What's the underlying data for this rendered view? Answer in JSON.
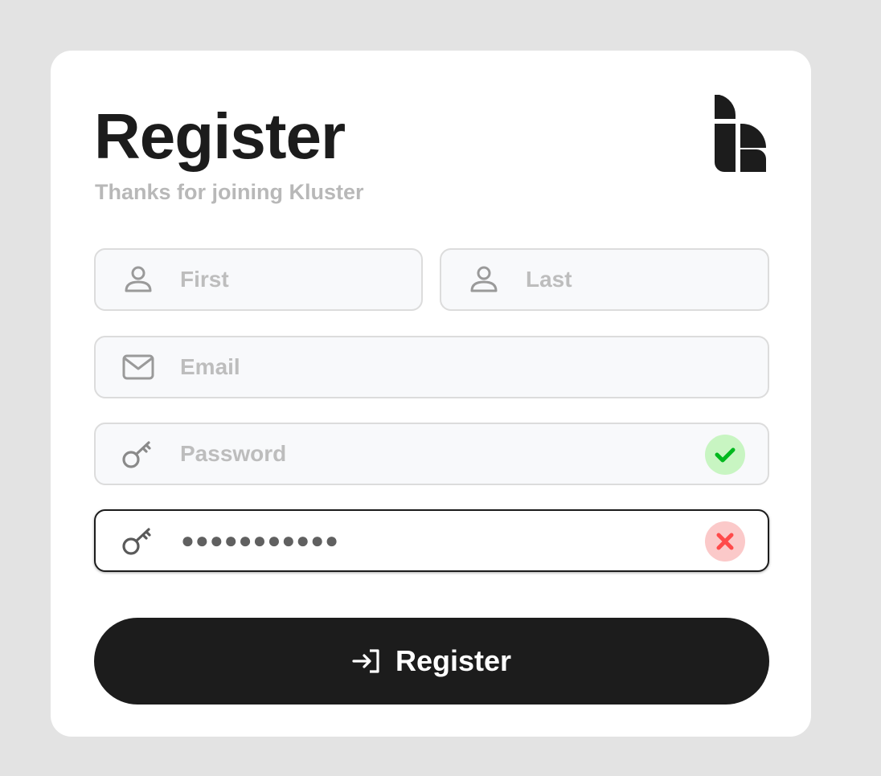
{
  "header": {
    "title": "Register",
    "subtitle": "Thanks for joining Kluster"
  },
  "brand": {
    "logo_icon": "kluster-logo-icon",
    "color": "#1c1c1c"
  },
  "form": {
    "first_name": {
      "placeholder": "First",
      "value": "",
      "icon": "user-icon"
    },
    "last_name": {
      "placeholder": "Last",
      "value": "",
      "icon": "user-icon"
    },
    "email": {
      "placeholder": "Email",
      "value": "",
      "icon": "mail-icon"
    },
    "password": {
      "placeholder": "Password",
      "value": "",
      "icon": "key-icon",
      "status": "valid",
      "status_icon": "check-icon",
      "status_color": "#00b81e"
    },
    "confirm_password": {
      "masked_value": "●●●●●●●●●●●",
      "icon": "key-icon",
      "status": "invalid",
      "status_icon": "x-icon",
      "status_color": "#ff4a4a"
    }
  },
  "submit": {
    "label": "Register",
    "icon": "login-arrow-icon"
  },
  "colors": {
    "background": "#e3e3e3",
    "card": "#ffffff",
    "accent": "#1c1c1c",
    "muted": "#b8b8b8"
  }
}
